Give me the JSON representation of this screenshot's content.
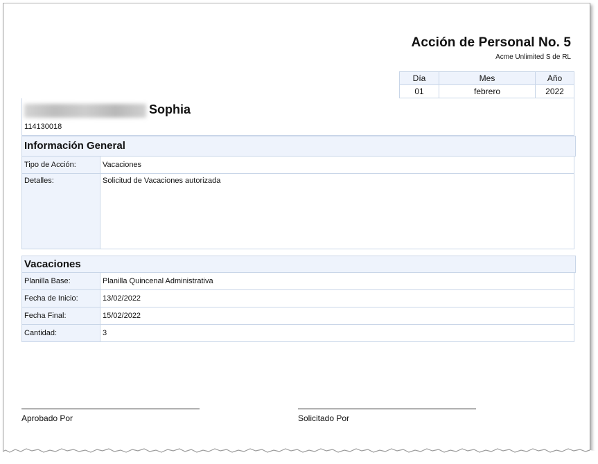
{
  "document": {
    "title": "Acción de Personal No. 5",
    "company": "Acme Unlimited S de RL"
  },
  "date": {
    "headers": [
      "Día",
      "Mes",
      "Año"
    ],
    "values": [
      "01",
      "febrero",
      "2022"
    ]
  },
  "person": {
    "first_name": "Sophia",
    "id": "114130018"
  },
  "general": {
    "title": "Información General",
    "rows": [
      {
        "label": "Tipo de Acción:",
        "value": "Vacaciones"
      },
      {
        "label": "Detalles:",
        "value": "Solicitud de Vacaciones autorizada"
      }
    ]
  },
  "vacation": {
    "title": "Vacaciones",
    "rows": [
      {
        "label": "Planilla Base:",
        "value": "Planilla Quincenal Administrativa"
      },
      {
        "label": "Fecha de Inicio:",
        "value": "13/02/2022"
      },
      {
        "label": "Fecha Final:",
        "value": "15/02/2022"
      },
      {
        "label": "Cantidad:",
        "value": "3"
      }
    ]
  },
  "signatures": {
    "approved_by": "Aprobado Por",
    "requested_by": "Solicitado Por"
  }
}
